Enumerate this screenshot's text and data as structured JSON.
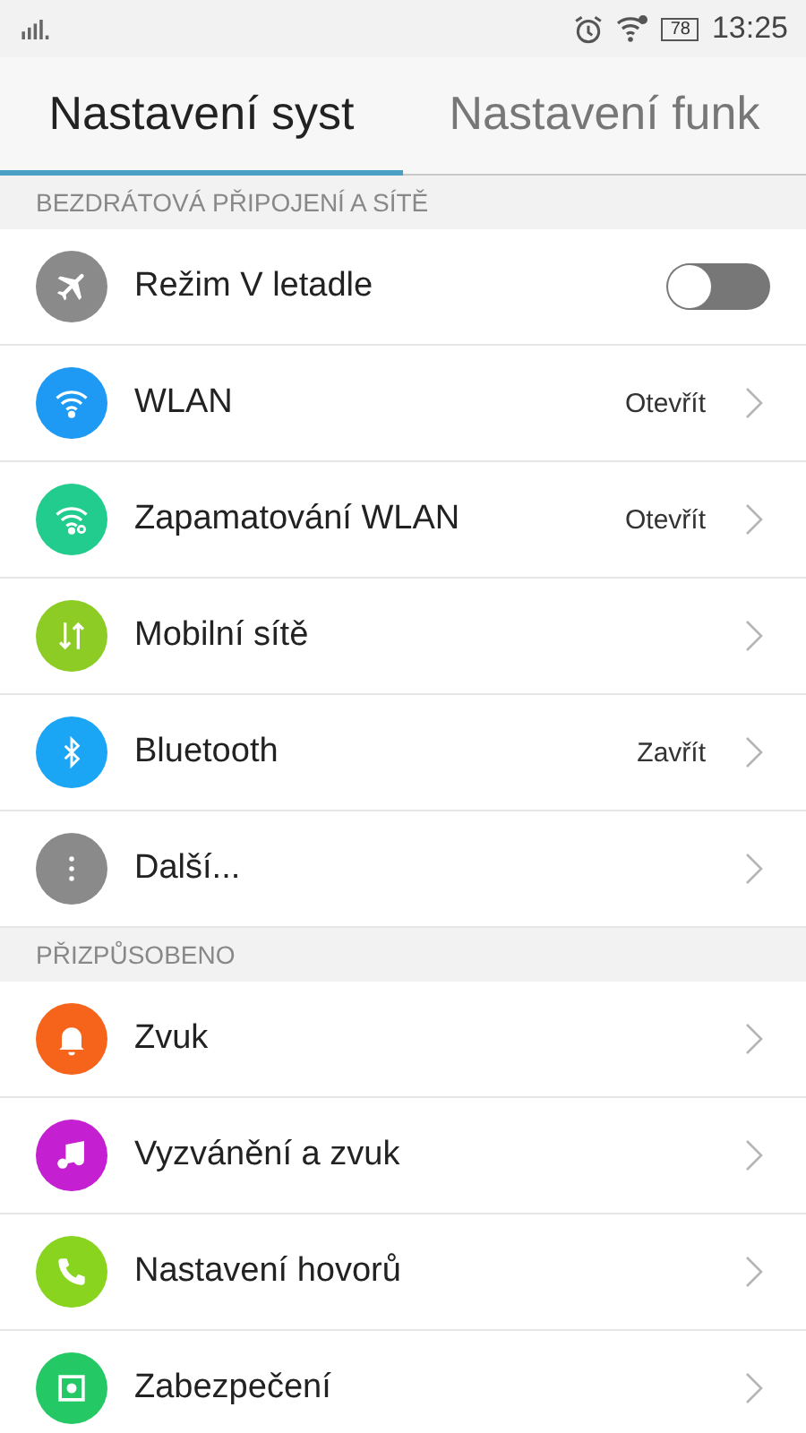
{
  "status_bar": {
    "battery": "78",
    "time": "13:25"
  },
  "tabs": [
    {
      "label": "Nastavení syst",
      "selected": true
    },
    {
      "label": "Nastavení funk",
      "selected": false
    }
  ],
  "sections": [
    {
      "header": "BEZDRÁTOVÁ PŘIPOJENÍ A SÍTĚ",
      "items": [
        {
          "title": "Režim V letadle",
          "color": "#8a8a8a",
          "kind": "toggle",
          "on": false
        },
        {
          "title": "WLAN",
          "color": "#1e9af5",
          "kind": "link",
          "value": "Otevřít"
        },
        {
          "title": "Zapamatování WLAN",
          "color": "#22cc8e",
          "kind": "link",
          "value": "Otevřít"
        },
        {
          "title": "Mobilní sítě",
          "color": "#8ccc24",
          "kind": "link"
        },
        {
          "title": "Bluetooth",
          "color": "#1aa6f5",
          "kind": "link",
          "value": "Zavřít"
        },
        {
          "title": "Další...",
          "color": "#8a8a8a",
          "kind": "link"
        }
      ]
    },
    {
      "header": "PŘIZPŮSOBENO",
      "items": [
        {
          "title": "Zvuk",
          "color": "#f5641a",
          "kind": "link"
        },
        {
          "title": "Vyzvánění a zvuk",
          "color": "#c41fd0",
          "kind": "link"
        },
        {
          "title": "Nastavení hovorů",
          "color": "#88d41f",
          "kind": "link"
        },
        {
          "title": "Zabezpečení",
          "color": "#24c864",
          "kind": "link"
        }
      ]
    }
  ]
}
